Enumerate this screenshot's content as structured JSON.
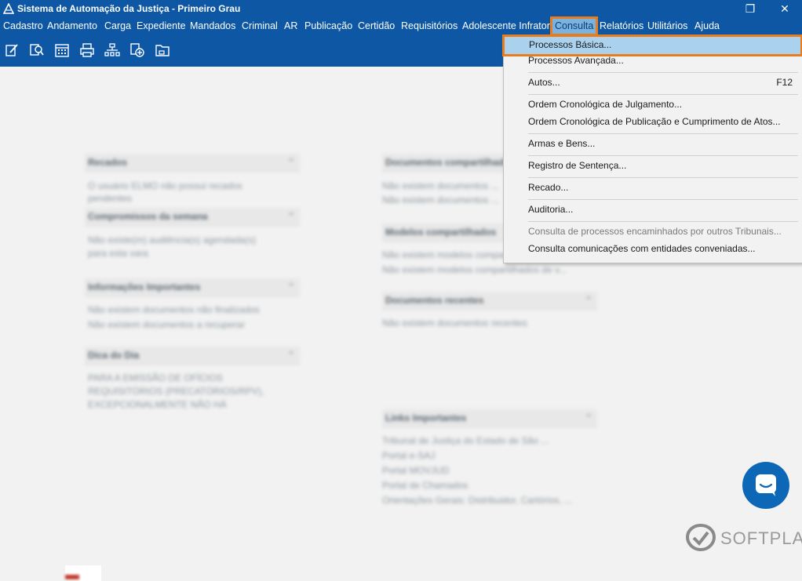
{
  "window": {
    "title": "Sistema de Automação da Justiça - Primeiro Grau",
    "restore_icon": "❐",
    "close_icon": "✕"
  },
  "menubar": {
    "items": [
      "Cadastro",
      "Andamento",
      "Carga",
      "Expediente",
      "Mandados",
      "Criminal",
      "AR",
      "Publicação",
      "Certidão",
      "Requisitórios",
      "Adolescente Infrator",
      "Consulta",
      "Relatórios",
      "Utilitários",
      "Ajuda"
    ],
    "active": "Consulta"
  },
  "toolbar": {
    "icons": [
      "edit-document-icon",
      "search-document-icon",
      "calendar-icon",
      "printer-icon",
      "org-chart-icon",
      "add-document-icon",
      "folder-icon"
    ]
  },
  "consulta_menu": [
    {
      "label": "Processos Básica...",
      "shortcut": "",
      "highlighted": true
    },
    {
      "label": "Processos Avançada...",
      "shortcut": ""
    },
    {
      "label": "Autos...",
      "shortcut": "F12"
    },
    {
      "label": "Ordem Cronológica de Julgamento...",
      "shortcut": ""
    },
    {
      "label": "Ordem Cronológica de Publicação e Cumprimento de Atos...",
      "shortcut": ""
    },
    {
      "label": "Armas e Bens...",
      "shortcut": ""
    },
    {
      "label": "Registro de Sentença...",
      "shortcut": ""
    },
    {
      "label": "Recado...",
      "shortcut": ""
    },
    {
      "label": "Auditoria...",
      "shortcut": ""
    },
    {
      "label": "Consulta de processos encaminhados por outros Tribunais...",
      "shortcut": "",
      "disabled": true
    },
    {
      "label": "Consulta comunicações com entidades conveniadas...",
      "shortcut": ""
    }
  ],
  "panels": {
    "recados": {
      "title": "Recados",
      "text": [
        "O usuário ELMO não possui recados",
        "pendentes"
      ]
    },
    "compromissos": {
      "title": "Compromissos da semana",
      "text": [
        "Não existe(m) audiência(s) agendada(s)",
        "para esta vara"
      ]
    },
    "informacoes": {
      "title": "Informações Importantes",
      "text": [
        "Não existem documentos não finalizados",
        "Não existem documentos a recuperar"
      ]
    },
    "dica": {
      "title": "Dica do Dia",
      "text": [
        "PARA A EMISSÃO DE OFÍCIOS",
        "REQUISITÓRIOS (PRECATÓRIOS/RPV),",
        "EXCEPCIONALMENTE NÃO HÁ"
      ]
    },
    "docs_compartilhados": {
      "title": "Documentos compartilhados",
      "text": [
        "Não existem documentos ...",
        "Não existem documentos ..."
      ]
    },
    "modelos": {
      "title": "Modelos compartilhados",
      "text": [
        "Não existem modelos compartilhados",
        "Não existem modelos compartilhados de v..."
      ]
    },
    "docs_recentes": {
      "title": "Documentos recentes",
      "text": [
        "Não existem documentos recentes"
      ]
    },
    "links": {
      "title": "Links Importantes",
      "text": [
        "Tribunal de Justiça do Estado de São ...",
        "Portal e-SAJ",
        "Portal MOVJUD",
        "Portal de Chamados",
        "Orientações Gerais: Distribuidor, Cartórios, ..."
      ]
    }
  },
  "branding": {
    "logo_text": "SOFTPLAN"
  }
}
